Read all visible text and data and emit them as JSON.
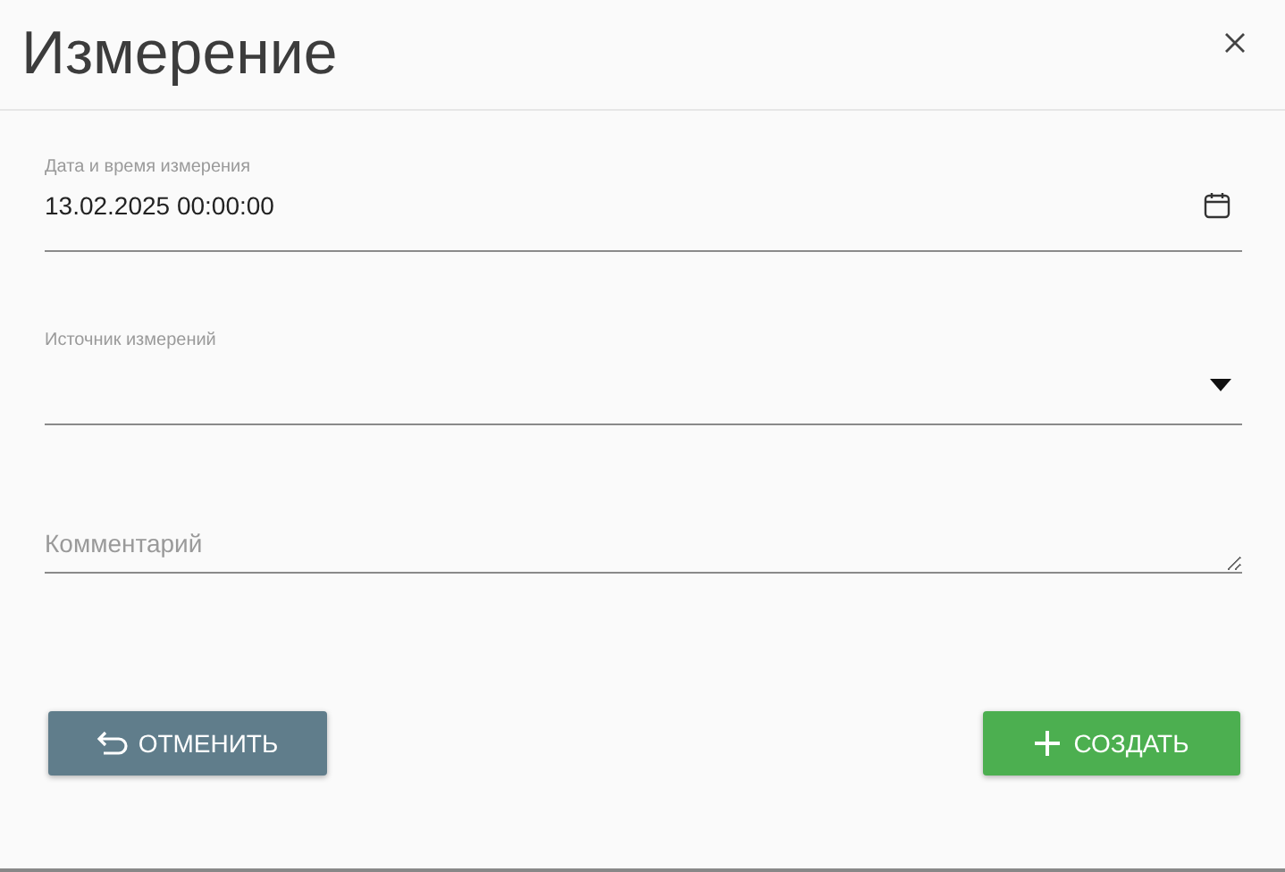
{
  "dialog": {
    "title": "Измерение"
  },
  "fields": [
    {
      "kind": "date",
      "label": "Дата и время измерения",
      "value": "13.02.2025 00:00:00"
    },
    {
      "kind": "select",
      "label": "Источник измерений"
    },
    {
      "kind": "textarea",
      "placeholder": "Комментарий"
    }
  ],
  "buttons": [
    {
      "kind": "cancel",
      "label": "ОТМЕНИТЬ"
    },
    {
      "kind": "create",
      "label": "СОЗДАТЬ"
    }
  ]
}
